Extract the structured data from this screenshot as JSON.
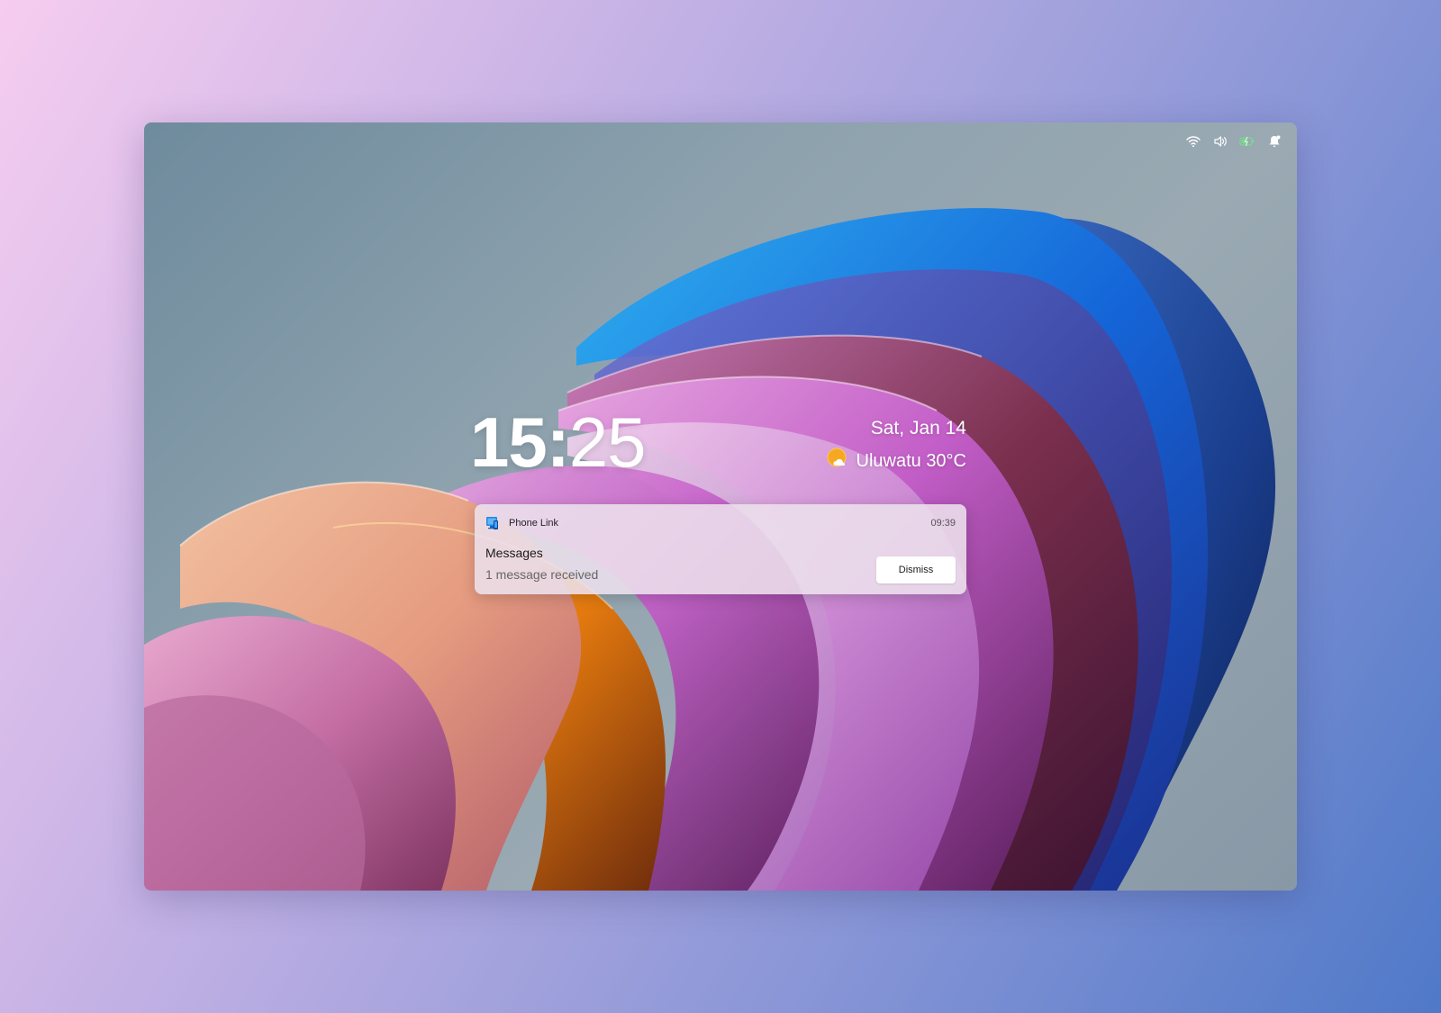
{
  "lock_screen": {
    "time_hours": "15",
    "time_separator": ":",
    "time_minutes": "25",
    "date": "Sat, Jan 14",
    "weather": {
      "icon": "partly-cloudy-sun-icon",
      "text": "Uluwatu 30°C"
    }
  },
  "tray": {
    "icons": [
      "wifi-icon",
      "volume-icon",
      "battery-charging-icon",
      "notification-bell-icon"
    ]
  },
  "notification": {
    "app_name": "Phone Link",
    "app_icon": "phone-link-icon",
    "time": "09:39",
    "title": "Messages",
    "body": "1 message received",
    "dismiss_label": "Dismiss"
  },
  "colors": {
    "accent_blue": "#1e88e5",
    "battery_green": "#7bd88f",
    "sun_orange": "#f7a823"
  }
}
